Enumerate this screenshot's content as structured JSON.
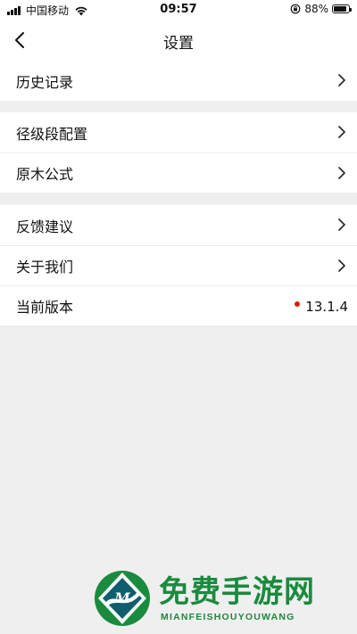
{
  "status_bar": {
    "carrier": "中国移动",
    "time": "09:57",
    "battery_percent": "88%",
    "battery_level": 0.88,
    "icons": [
      "signal-icon",
      "wifi-icon",
      "orientation-lock-icon",
      "battery-icon"
    ]
  },
  "nav": {
    "title": "设置",
    "back_icon": "chevron-left-icon"
  },
  "groups": [
    {
      "items": [
        {
          "label": "历史记录",
          "icon": "chevron-right-icon"
        }
      ]
    },
    {
      "items": [
        {
          "label": "径级段配置",
          "icon": "chevron-right-icon"
        },
        {
          "label": "原木公式",
          "icon": "chevron-right-icon"
        }
      ]
    },
    {
      "items": [
        {
          "label": "反馈建议",
          "icon": "chevron-right-icon"
        },
        {
          "label": "关于我们",
          "icon": "chevron-right-icon"
        },
        {
          "label": "当前版本",
          "value": "13.1.4",
          "badge_color": "#d81e06"
        }
      ]
    }
  ],
  "watermark": {
    "text": "免费手游网",
    "sub": "MIANFEISHOUYOUWANG",
    "color": "#1a8a3e"
  }
}
